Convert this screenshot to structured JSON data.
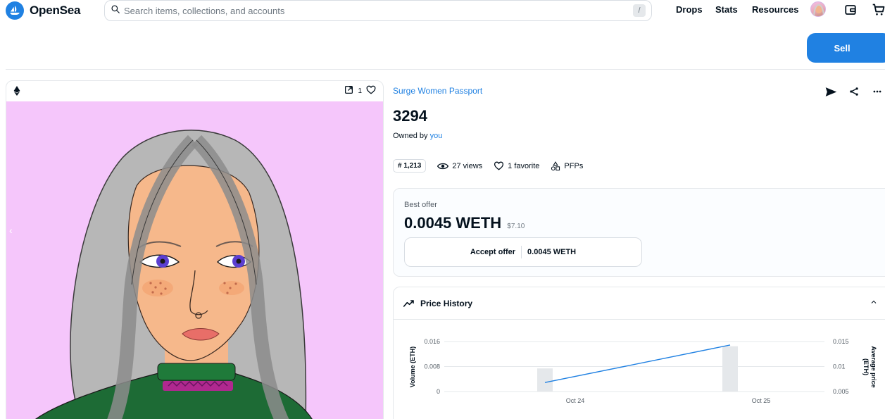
{
  "header": {
    "logo_text": "OpenSea",
    "search_placeholder": "Search items, collections, and accounts",
    "search_shortcut": "/",
    "nav": [
      "Drops",
      "Stats",
      "Resources"
    ],
    "sell_label": "Sell"
  },
  "card": {
    "favorites_count": "1",
    "left_chevron": "‹"
  },
  "item": {
    "collection": "Surge Women Passport",
    "title": "3294",
    "owned_by_label": "Owned by",
    "owner": "you",
    "rank": "# 1,213",
    "views": "27 views",
    "favorites": "1 favorite",
    "category": "PFPs"
  },
  "offer": {
    "label": "Best offer",
    "value": "0.0045 WETH",
    "usd": "$7.10",
    "accept_label": "Accept offer",
    "accept_value": "0.0045 WETH"
  },
  "history": {
    "title": "Price History"
  },
  "colors": {
    "brand": "#2081e2",
    "text": "#04111d",
    "art_bg": "#f5c6fb"
  },
  "icons": {
    "logo": "opensea-boat-icon",
    "search": "search-icon",
    "wallet": "wallet-icon",
    "cart": "cart-icon",
    "eth": "ethereum-icon",
    "external": "external-link-icon",
    "favorite": "heart-icon",
    "transfer": "send-icon",
    "share": "share-icon",
    "more": "more-icon",
    "views": "eye-icon",
    "category": "shapes-icon",
    "trend": "trend-line-icon",
    "collapse": "chevron-up-icon"
  },
  "chart_data": {
    "type": "bar",
    "x": [
      "Oct 24",
      "Oct 25"
    ],
    "y_left_label": "Volume (ETH)",
    "y_right_label": "Average price (ETH)",
    "y_left_ticks": [
      "0.016",
      "0.008",
      "0"
    ],
    "y_right_ticks": [
      "0.015",
      "0.01",
      "0.005"
    ],
    "y_left_range": [
      0,
      0.016
    ],
    "y_right_range": [
      0.005,
      0.015
    ],
    "volume": [
      0.0074,
      0.0145
    ],
    "average_price": [
      0.0068,
      0.0143
    ],
    "colors": {
      "bar": "#e5e8eb",
      "line": "#2081e2"
    }
  }
}
